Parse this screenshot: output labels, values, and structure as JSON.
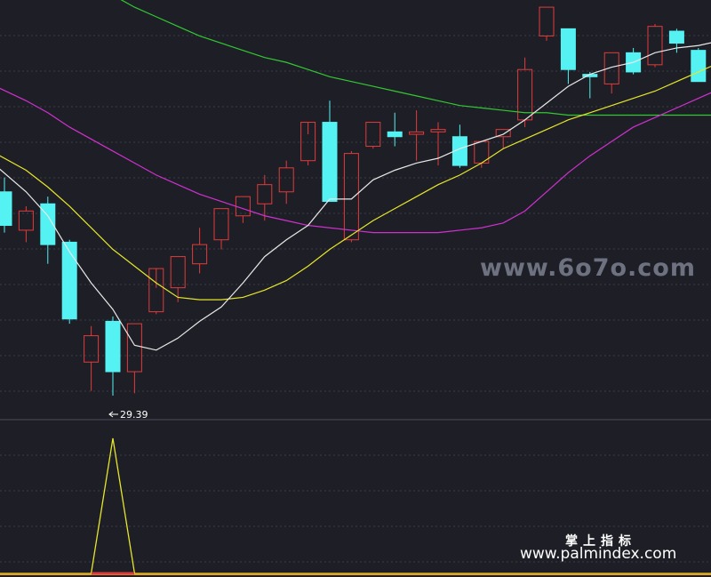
{
  "watermark": {
    "site": "www.6o7o.com",
    "brand_cn": "掌上指标",
    "brand_url": "www.palmindex.com"
  },
  "colors": {
    "background": "#1e1f26",
    "grid": "#3a3c48",
    "up": "#e03b3b",
    "down": "#54f2f2",
    "ma_white": "#e8e8e8",
    "ma_yellow": "#e6e62a",
    "ma_magenta": "#d030d0",
    "ma_green": "#32c832",
    "indicator": "#e6e62a",
    "baseline": "#e8a020"
  },
  "chart_data": [
    {
      "type": "candlestick",
      "title": "",
      "price_range": [
        28.5,
        46.0
      ],
      "low_marker": {
        "label": "29.39",
        "value": 29.39,
        "candle_index": 5
      },
      "candles": [
        {
          "o": 38.0,
          "h": 38.6,
          "c": 36.6,
          "l": 36.3
        },
        {
          "o": 36.4,
          "h": 37.4,
          "c": 37.2,
          "l": 35.9
        },
        {
          "o": 37.5,
          "h": 37.8,
          "c": 35.8,
          "l": 35.0
        },
        {
          "o": 35.9,
          "h": 36.0,
          "c": 32.7,
          "l": 32.5
        },
        {
          "o": 30.9,
          "h": 32.4,
          "c": 32.0,
          "l": 29.7
        },
        {
          "o": 32.6,
          "h": 32.8,
          "c": 30.5,
          "l": 29.5
        },
        {
          "o": 30.5,
          "h": 32.5,
          "c": 32.5,
          "l": 29.6
        },
        {
          "o": 33.0,
          "h": 34.0,
          "c": 34.8,
          "l": 32.9
        },
        {
          "o": 34.0,
          "h": 35.3,
          "c": 35.3,
          "l": 33.4
        },
        {
          "o": 35.0,
          "h": 36.5,
          "c": 35.8,
          "l": 34.6
        },
        {
          "o": 36.0,
          "h": 37.3,
          "c": 37.3,
          "l": 35.6
        },
        {
          "o": 37.0,
          "h": 37.8,
          "c": 37.8,
          "l": 36.7
        },
        {
          "o": 37.5,
          "h": 38.7,
          "c": 38.3,
          "l": 36.8
        },
        {
          "o": 38.0,
          "h": 39.3,
          "c": 39.0,
          "l": 37.5
        },
        {
          "o": 39.3,
          "h": 40.4,
          "c": 40.9,
          "l": 39.1
        },
        {
          "o": 40.9,
          "h": 41.8,
          "c": 37.6,
          "l": 37.6
        },
        {
          "o": 36.0,
          "h": 39.7,
          "c": 39.6,
          "l": 35.9
        },
        {
          "o": 39.9,
          "h": 40.9,
          "c": 40.9,
          "l": 39.8
        },
        {
          "o": 40.5,
          "h": 41.3,
          "c": 40.3,
          "l": 39.9
        },
        {
          "o": 40.4,
          "h": 41.4,
          "c": 40.5,
          "l": 39.3
        },
        {
          "o": 40.5,
          "h": 40.9,
          "c": 40.6,
          "l": 39.1
        },
        {
          "o": 40.3,
          "h": 40.8,
          "c": 39.1,
          "l": 39.0
        },
        {
          "o": 39.2,
          "h": 40.1,
          "c": 40.1,
          "l": 39.0
        },
        {
          "o": 40.3,
          "h": 40.6,
          "c": 40.6,
          "l": 39.8
        },
        {
          "o": 41.0,
          "h": 43.6,
          "c": 43.1,
          "l": 40.7
        },
        {
          "o": 44.5,
          "h": 45.7,
          "c": 45.7,
          "l": 44.3
        },
        {
          "o": 44.8,
          "h": 44.8,
          "c": 43.1,
          "l": 42.5
        },
        {
          "o": 42.9,
          "h": 43.0,
          "c": 42.8,
          "l": 41.9
        },
        {
          "o": 42.5,
          "h": 43.8,
          "c": 43.8,
          "l": 42.1
        },
        {
          "o": 43.8,
          "h": 44.0,
          "c": 43.0,
          "l": 42.9
        },
        {
          "o": 43.3,
          "h": 45.0,
          "c": 44.9,
          "l": 43.2
        },
        {
          "o": 44.7,
          "h": 44.8,
          "c": 44.2,
          "l": 43.8
        },
        {
          "o": 43.9,
          "h": 44.0,
          "c": 42.6,
          "l": 42.6
        },
        {
          "o": 43.9,
          "h": 46.0,
          "c": 44.7,
          "l": 43.9
        }
      ],
      "ma_white": [
        39.1,
        38.0,
        37.0,
        35.5,
        34.2,
        33.1,
        31.6,
        31.4,
        31.9,
        32.6,
        33.2,
        34.2,
        35.3,
        36.0,
        36.6,
        37.7,
        37.7,
        38.5,
        38.9,
        39.2,
        39.4,
        39.8,
        40.1,
        40.4,
        41.0,
        41.7,
        42.4,
        42.9,
        43.2,
        43.4,
        43.8,
        44.0,
        44.1,
        44.3
      ],
      "ma_yellow": [
        39.6,
        38.9,
        38.2,
        37.4,
        36.5,
        35.6,
        34.9,
        34.2,
        33.6,
        33.5,
        33.5,
        33.6,
        33.9,
        34.3,
        34.9,
        35.6,
        36.2,
        36.8,
        37.3,
        37.8,
        38.3,
        38.7,
        39.2,
        39.8,
        40.2,
        40.6,
        41.0,
        41.3,
        41.6,
        41.9,
        42.2,
        42.6,
        43.0,
        43.4
      ],
      "ma_magenta": [
        42.4,
        41.8,
        41.3,
        40.7,
        40.2,
        39.7,
        39.2,
        38.7,
        38.3,
        37.9,
        37.6,
        37.3,
        37.0,
        36.8,
        36.6,
        36.5,
        36.4,
        36.3,
        36.3,
        36.3,
        36.3,
        36.4,
        36.5,
        36.7,
        37.2,
        38.0,
        38.8,
        39.5,
        40.1,
        40.7,
        41.1,
        41.5,
        41.9,
        42.3
      ],
      "ma_green": [
        48.5,
        48.0,
        47.5,
        47.0,
        46.6,
        46.2,
        45.7,
        45.3,
        44.9,
        44.5,
        44.2,
        43.9,
        43.6,
        43.4,
        43.1,
        42.8,
        42.6,
        42.4,
        42.2,
        42.0,
        41.8,
        41.6,
        41.5,
        41.4,
        41.3,
        41.3,
        41.2,
        41.2,
        41.2,
        41.2,
        41.2,
        41.2,
        41.2,
        41.2
      ]
    },
    {
      "type": "line",
      "title": "",
      "y_range": [
        0,
        1
      ],
      "values": [
        0,
        0,
        0,
        0,
        0,
        1,
        0,
        0,
        0,
        0,
        0,
        0,
        0,
        0,
        0,
        0,
        0,
        0,
        0,
        0,
        0,
        0,
        0,
        0,
        0,
        0,
        0,
        0,
        0,
        0,
        0,
        0,
        0,
        0
      ]
    }
  ]
}
